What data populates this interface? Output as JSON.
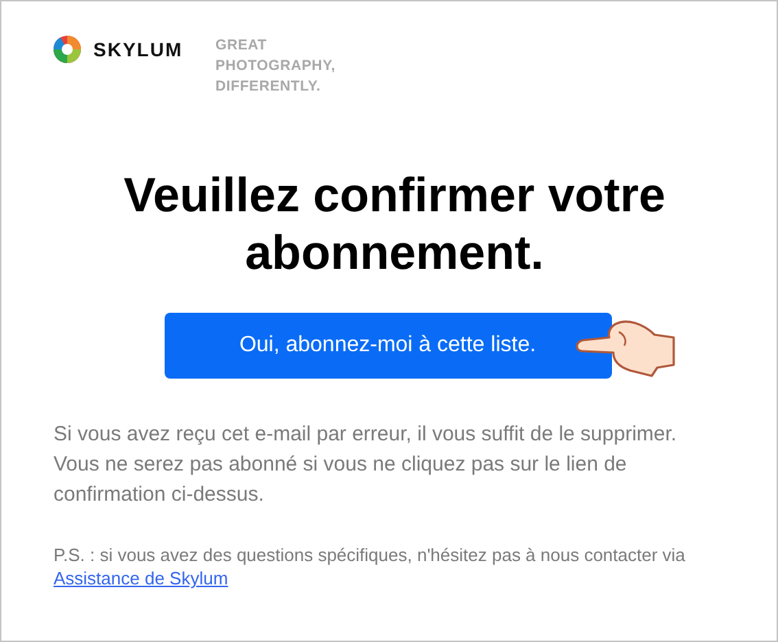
{
  "header": {
    "brand": "SKYLUM",
    "tagline": [
      "GREAT",
      "PHOTOGRAPHY,",
      "DIFFERENTLY."
    ]
  },
  "headline": "Veuillez confirmer votre abonnement.",
  "confirm_button": {
    "label": "Oui, abonnez-moi à cette liste."
  },
  "body": "Si vous avez reçu cet e-mail par erreur, il vous suffit de le supprimer. Vous ne serez pas abonné si vous ne cliquez pas sur le lien de confirmation ci-dessus.",
  "ps": {
    "text": "P.S. : si vous avez des questions spécifiques, n'hésitez pas à nous contacter via",
    "link": "Assistance de Skylum"
  }
}
